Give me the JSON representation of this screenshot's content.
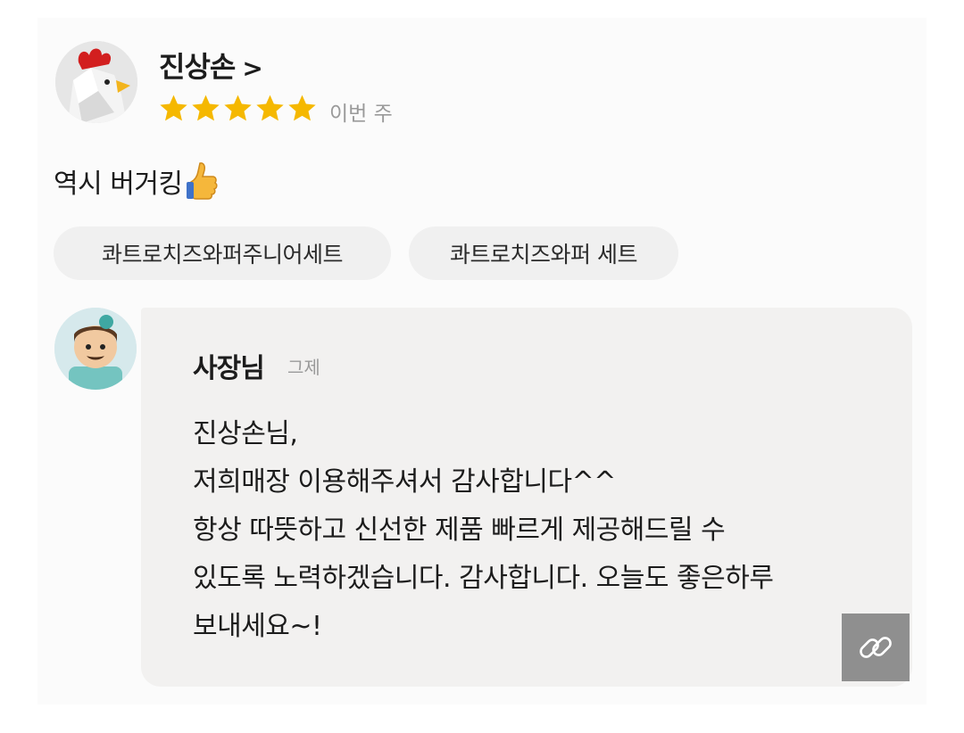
{
  "review": {
    "reviewer_name": "진상손",
    "name_chevron": ">",
    "rating": 5,
    "rating_max": 5,
    "time": "이번 주",
    "text": "역시 버거킹",
    "text_icon": "thumbs-up-icon",
    "menu_items": [
      "콰트로치즈와퍼주니어세트",
      "콰트로치즈와퍼 세트"
    ]
  },
  "reply": {
    "author": "사장님",
    "time": "그제",
    "lines": [
      "진상손님,",
      "저희매장 이용해주셔서 감사합니다^^",
      "항상 따뜻하고 신선한 제품 빠르게 제공해드릴 수",
      "있도록 노력하겠습니다. 감사합니다. 오늘도 좋은하루",
      "보내세요~!"
    ]
  },
  "overlay": {
    "link_icon": "link-icon"
  },
  "colors": {
    "star": "#f5b800",
    "muted_text": "#9a9a9a",
    "chip_bg": "#f0f0f0",
    "bubble_bg": "#f2f1f0",
    "link_button_bg": "#8f8f8f"
  }
}
